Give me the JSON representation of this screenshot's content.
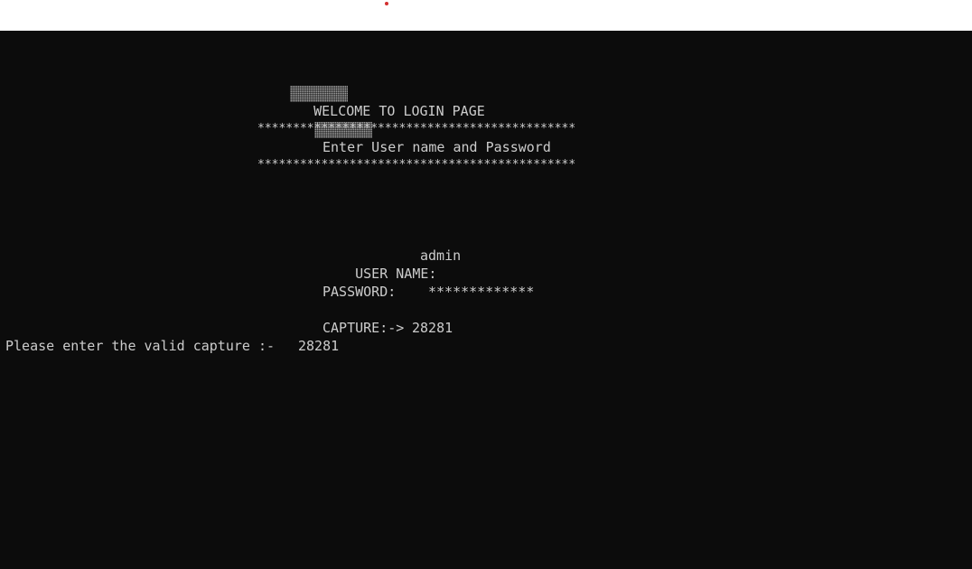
{
  "console": {
    "title_text": "WELCOME TO LOGIN PAGE",
    "star_border": "*********************************************",
    "subtitle": "Enter User name and Password",
    "username_label": "USER NAME:",
    "username_value": "admin",
    "password_label": "PASSWORD:",
    "password_value": "*************",
    "capture_label": "CAPTURE:->",
    "capture_value": "28281",
    "prompt_text": "Please enter the valid capture :-",
    "prompt_value": "28281"
  }
}
